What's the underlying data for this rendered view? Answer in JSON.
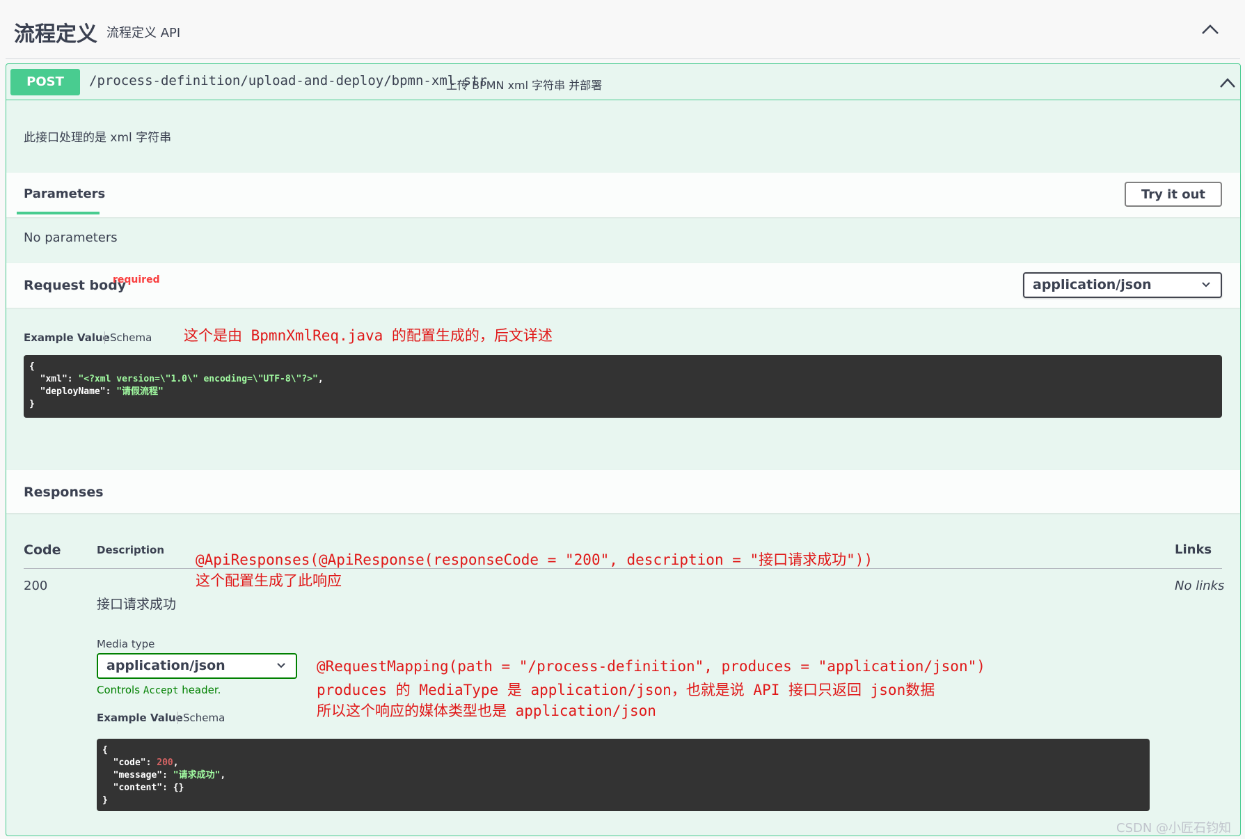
{
  "tag": {
    "title": "流程定义",
    "description": "流程定义 API"
  },
  "operation": {
    "method": "POST",
    "path": "/process-definition/upload-and-deploy/bpmn-xml-str",
    "summary": "上传 BPMN xml 字符串 并部署",
    "description": "此接口处理的是 xml 字符串",
    "method_color": "#49cc90"
  },
  "parameters": {
    "tab_label": "Parameters",
    "try_it_out": "Try it out",
    "empty_text": "No parameters"
  },
  "request_body": {
    "title": "Request body",
    "required_label": "required",
    "content_type": "application/json",
    "example_tab": "Example Value",
    "schema_tab": "Schema",
    "example_lines": {
      "open": "{",
      "xml_key": "\"xml\"",
      "xml_value": "\"<?xml version=\\\"1.0\\\" encoding=\\\"UTF-8\\\"?>\"",
      "deploy_key": "\"deployName\"",
      "deploy_value": "\"请假流程\"",
      "close": "}"
    }
  },
  "responses": {
    "title": "Responses",
    "col_code": "Code",
    "col_description": "Description",
    "col_links": "Links",
    "rows": [
      {
        "code": "200",
        "description": "接口请求成功",
        "links": "No links",
        "media_type_label": "Media type",
        "media_type": "application/json",
        "controls_note_prefix": "Controls",
        "controls_note_code": "Accept",
        "controls_note_suffix": "header.",
        "example_tab": "Example Value",
        "schema_tab": "Schema",
        "example_lines": {
          "open": "{",
          "code_key": "\"code\"",
          "code_value": "200",
          "message_key": "\"message\"",
          "message_value": "\"请求成功\"",
          "content_key": "\"content\"",
          "content_value": "{}",
          "close": "}"
        }
      }
    ]
  },
  "annotations": {
    "request_note": "这个是由 BpmnXmlReq.java 的配置生成的，后文详述",
    "response_note_1": "@ApiResponses(@ApiResponse(responseCode = \"200\", description = \"接口请求成功\"))",
    "response_note_2": "这个配置生成了此响应",
    "mapping_note_1": "@RequestMapping(path = \"/process-definition\", produces = \"application/json\")",
    "mapping_note_2": "produces 的 MediaType 是 application/json，也就是说 API 接口只返回 json数据",
    "mapping_note_3": "所以这个响应的媒体类型也是 application/json",
    "color": "#e01818"
  },
  "watermark": "CSDN @小匠石钧知"
}
